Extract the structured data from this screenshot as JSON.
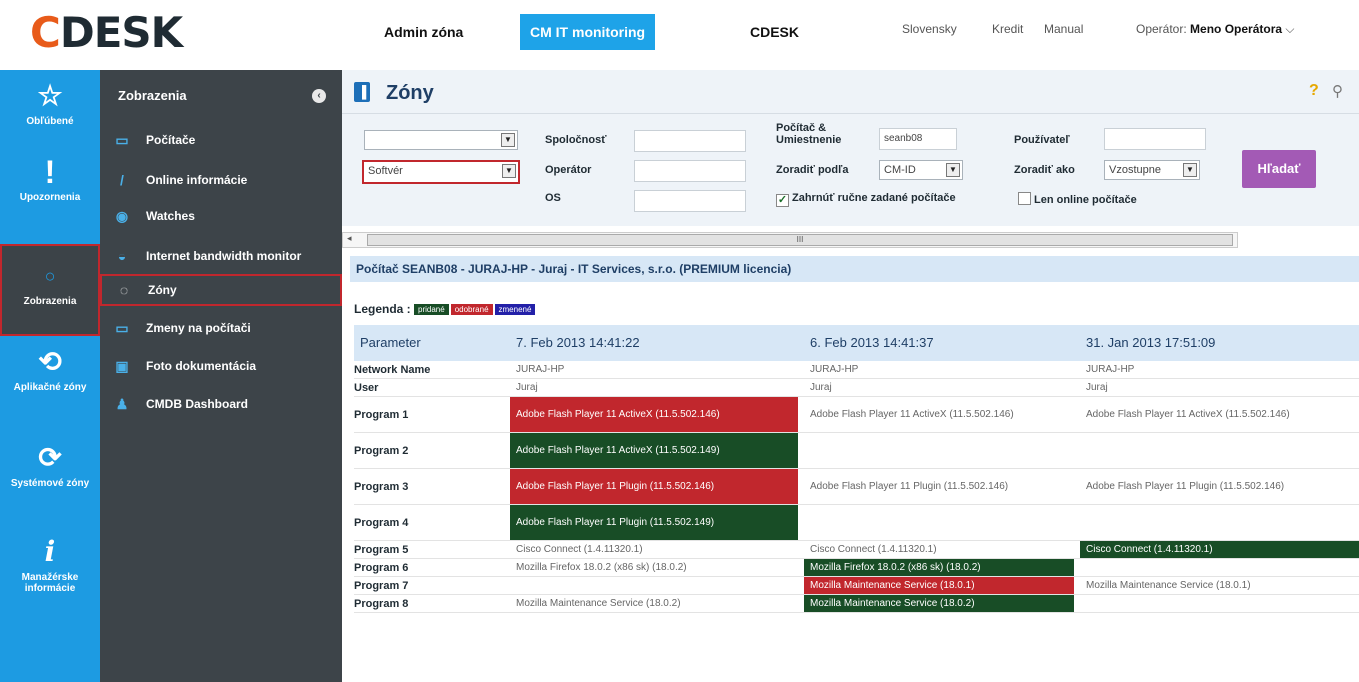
{
  "topbar": {
    "logo_accent": "C",
    "logo_rest": "DESK",
    "nav": [
      "Admin zóna",
      "CM IT monitoring",
      "CDESK"
    ],
    "links": [
      "Slovensky",
      "Kredit",
      "Manual"
    ],
    "operator_label": "Operátor:",
    "operator_name": "Meno Operátora"
  },
  "iconbar": [
    {
      "label": "Obľúbené",
      "icon": "star-icon"
    },
    {
      "label": "Upozornenia",
      "icon": "exclamation-icon"
    },
    {
      "label": "Zobrazenia",
      "icon": "eye-icon"
    },
    {
      "label": "Aplikačné zóny",
      "icon": "app-zone-icon"
    },
    {
      "label": "Systémové zóny",
      "icon": "system-zone-icon"
    },
    {
      "label": "Manažérske informácie",
      "icon": "info-icon"
    }
  ],
  "sidebar": {
    "title": "Zobrazenia",
    "items": [
      "Počítače",
      "Online informácie",
      "Watches",
      "Internet bandwidth monitor",
      "Zóny",
      "Zmeny na počítači",
      "Foto dokumentácia",
      "CMDB Dashboard"
    ]
  },
  "page": {
    "title": "Zóny",
    "help": "?"
  },
  "filters": {
    "select1": "",
    "select2": "Softvér",
    "spolocnost_label": "Spoločnosť",
    "operator_label": "Operátor",
    "os_label": "OS",
    "pocitac_label_1": "Počítač &",
    "pocitac_label_2": "Umiestnenie",
    "pocitac_value": "seanb08",
    "zoradit_podla_label": "Zoradiť podľa",
    "zoradit_podla_value": "CM-ID",
    "pouzivatel_label": "Používateľ",
    "zoradit_ako_label": "Zoradiť ako",
    "zoradit_ako_value": "Vzostupne",
    "manual_label": "Zahrnúť ručne zadané počítače",
    "online_label": "Len online počítače",
    "search_button": "Hľadať"
  },
  "scroll_label": "III",
  "pc_header": "Počítač SEANB08 - JURAJ-HP - Juraj - IT Services, s.r.o. (PREMIUM licencia)",
  "legend": {
    "label": "Legenda :",
    "added": "pridané",
    "removed": "odobrané",
    "changed": "zmenené"
  },
  "table": {
    "headers": [
      "Parameter",
      "7. Feb 2013 14:41:22",
      "6. Feb 2013 14:41:37",
      "31. Jan 2013 17:51:09"
    ],
    "rows": [
      {
        "p": "Network Name",
        "c": [
          "JURAJ-HP",
          "JURAJ-HP",
          "JURAJ-HP"
        ],
        "s": [
          "",
          "",
          ""
        ]
      },
      {
        "p": "User",
        "c": [
          "Juraj",
          "Juraj",
          "Juraj"
        ],
        "s": [
          "",
          "",
          ""
        ]
      },
      {
        "p": "Program 1",
        "c": [
          "Adobe Flash Player 11 ActiveX (11.5.502.146)",
          "Adobe Flash Player 11 ActiveX (11.5.502.146)",
          "Adobe Flash Player 11 ActiveX (11.5.502.146)"
        ],
        "s": [
          "removed",
          "",
          ""
        ]
      },
      {
        "p": "Program 2",
        "c": [
          "Adobe Flash Player 11 ActiveX (11.5.502.149)",
          "",
          ""
        ],
        "s": [
          "added",
          "",
          ""
        ]
      },
      {
        "p": "Program 3",
        "c": [
          "Adobe Flash Player 11 Plugin (11.5.502.146)",
          "Adobe Flash Player 11 Plugin (11.5.502.146)",
          "Adobe Flash Player 11 Plugin (11.5.502.146)"
        ],
        "s": [
          "removed",
          "",
          ""
        ]
      },
      {
        "p": "Program 4",
        "c": [
          "Adobe Flash Player 11 Plugin (11.5.502.149)",
          "",
          ""
        ],
        "s": [
          "added",
          "",
          ""
        ]
      },
      {
        "p": "Program 5",
        "c": [
          "Cisco Connect (1.4.11320.1)",
          "Cisco Connect (1.4.11320.1)",
          "Cisco Connect (1.4.11320.1)"
        ],
        "s": [
          "",
          "",
          "added"
        ]
      },
      {
        "p": "Program 6",
        "c": [
          "Mozilla Firefox 18.0.2 (x86 sk) (18.0.2)",
          "Mozilla Firefox 18.0.2 (x86 sk) (18.0.2)",
          ""
        ],
        "s": [
          "",
          "added",
          ""
        ]
      },
      {
        "p": "Program 7",
        "c": [
          "",
          "Mozilla Maintenance Service (18.0.1)",
          "Mozilla Maintenance Service (18.0.1)"
        ],
        "s": [
          "",
          "removed",
          ""
        ]
      },
      {
        "p": "Program 8",
        "c": [
          "Mozilla Maintenance Service (18.0.2)",
          "Mozilla Maintenance Service (18.0.2)",
          ""
        ],
        "s": [
          "",
          "added",
          ""
        ]
      }
    ]
  },
  "colors": {
    "brand_blue": "#1d9be2",
    "added": "#184d26",
    "removed": "#c1272d",
    "changed": "#2320a8",
    "search_button": "#a35ab5"
  }
}
